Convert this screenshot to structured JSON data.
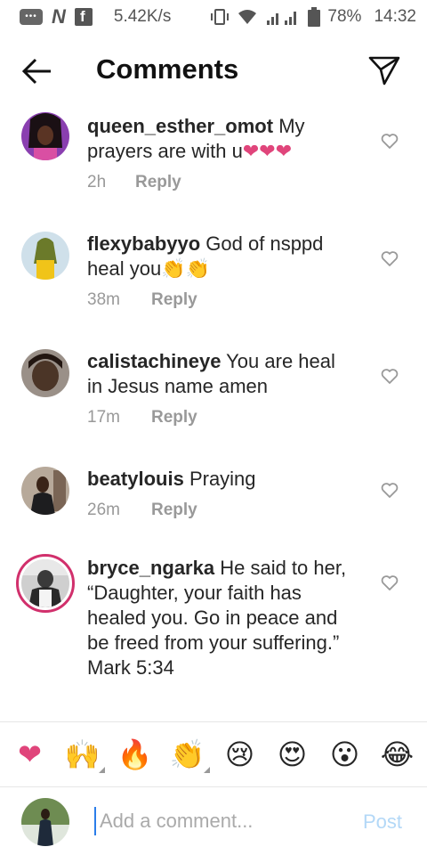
{
  "status_bar": {
    "speed": "5.42K/s",
    "battery": "78%",
    "time": "14:32"
  },
  "header": {
    "title": "Comments"
  },
  "comments": [
    {
      "username": "queen_esther_omot",
      "text": "My prayers are with u",
      "emoji": "❤❤❤",
      "time": "2h",
      "reply": "Reply"
    },
    {
      "username": "flexybabyyo",
      "text": "God of nsppd heal you",
      "emoji": "👏👏",
      "time": "38m",
      "reply": "Reply"
    },
    {
      "username": "calistachineye",
      "text": "You are heal in Jesus name amen",
      "emoji": "",
      "time": "17m",
      "reply": "Reply"
    },
    {
      "username": "beatylouis",
      "text": "Praying",
      "emoji": "",
      "time": "26m",
      "reply": "Reply"
    },
    {
      "username": "bryce_ngarka",
      "text": "He said to her, “Daughter, your faith has healed you. Go in peace and be freed from your suffering.”",
      "text2": "Mark 5:34",
      "emoji": ""
    }
  ],
  "emoji_bar": [
    "❤",
    "🙌",
    "🔥",
    "👏",
    "😢",
    "😍",
    "😮",
    "😂"
  ],
  "composer": {
    "placeholder": "Add a comment...",
    "post_label": "Post"
  },
  "colors": {
    "accent": "#b3d8f7",
    "heart": "#e0457b"
  }
}
